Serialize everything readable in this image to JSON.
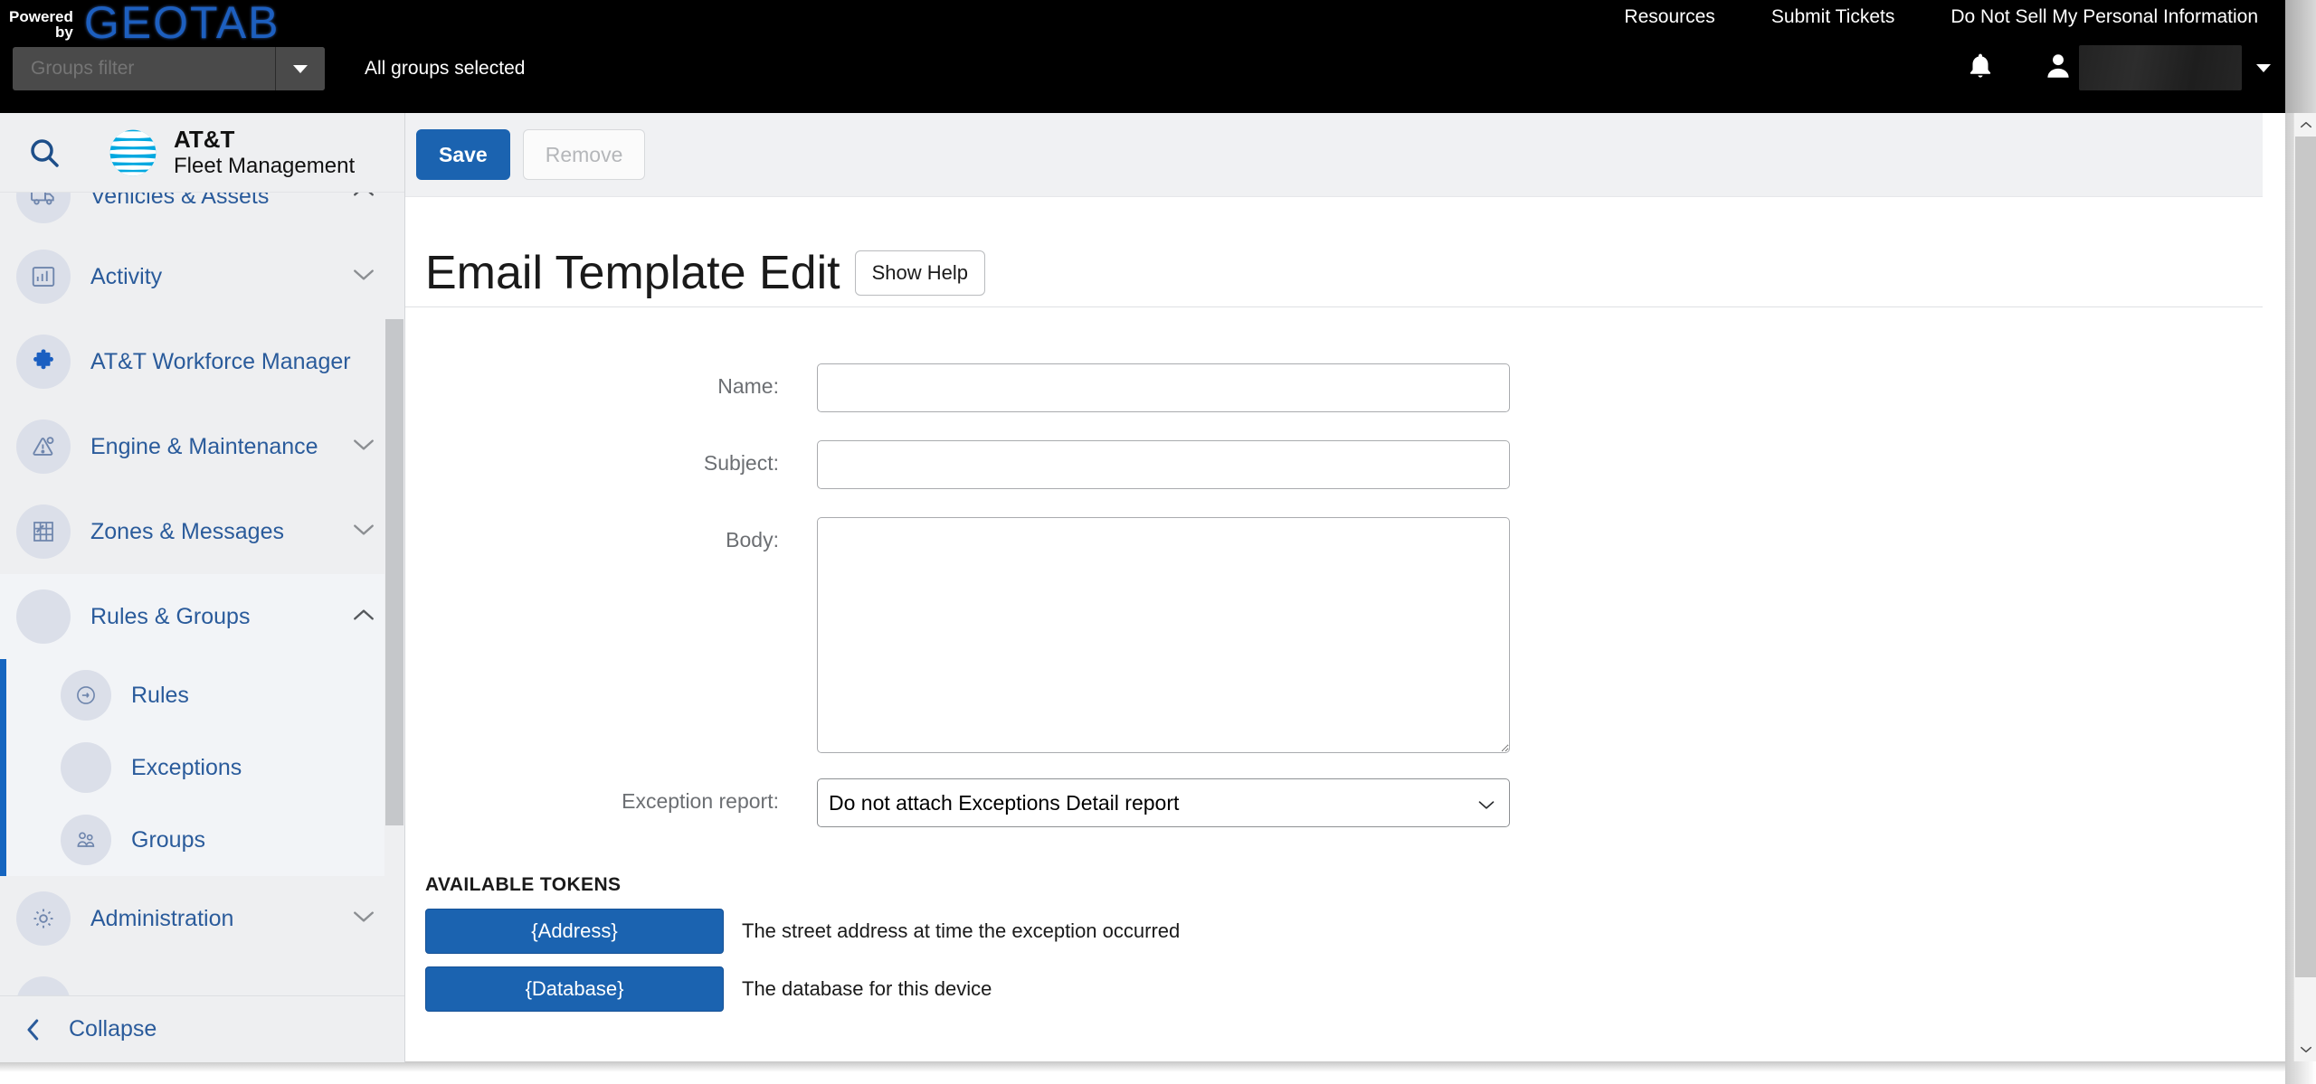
{
  "topbar": {
    "powered_line1": "Powered",
    "powered_line2": "by",
    "brand_word": "GEOTAB",
    "links": [
      {
        "label": "Resources",
        "name": "resources-link"
      },
      {
        "label": "Submit Tickets",
        "name": "submit-tickets-link"
      },
      {
        "label": "Do Not Sell My Personal Information",
        "name": "do-not-sell-link"
      }
    ],
    "groups_filter_placeholder": "Groups filter",
    "groups_filter_value": "",
    "all_groups_text": "All groups selected",
    "user_name": ""
  },
  "sidebar": {
    "product_name_line1": "AT&T",
    "product_name_line2": "Fleet Management",
    "items": [
      {
        "label": "Vehicles & Assets",
        "icon": "truck-icon",
        "chevron": "up",
        "expanded": false
      },
      {
        "label": "Activity",
        "icon": "bar-chart-icon",
        "chevron": "down",
        "expanded": false
      },
      {
        "label": "AT&T Workforce Manager",
        "icon": "puzzle-piece-icon",
        "chevron": "",
        "expanded": false
      },
      {
        "label": "Engine & Maintenance",
        "icon": "engine-warning-icon",
        "chevron": "down",
        "expanded": false
      },
      {
        "label": "Zones & Messages",
        "icon": "zones-map-icon",
        "chevron": "down",
        "expanded": false
      },
      {
        "label": "Rules & Groups",
        "icon": "rules-icon",
        "chevron": "up",
        "expanded": true
      }
    ],
    "sub_items": [
      {
        "label": "Rules",
        "icon": "rule-circle-icon"
      },
      {
        "label": "Exceptions",
        "icon": "exceptions-icon"
      },
      {
        "label": "Groups",
        "icon": "groups-people-icon"
      }
    ],
    "items_after": [
      {
        "label": "Administration",
        "icon": "gear-icon",
        "chevron": "down"
      }
    ],
    "collapse_label": "Collapse",
    "accent_color": "#1565c0",
    "link_color": "#2a5b9b"
  },
  "main": {
    "toolbar": {
      "save_label": "Save",
      "remove_label": "Remove"
    },
    "page_title": "Email Template Edit",
    "show_help_label": "Show Help",
    "form": {
      "name_label": "Name:",
      "name_value": "",
      "subject_label": "Subject:",
      "subject_value": "",
      "body_label": "Body:",
      "body_value": "",
      "exception_report_label": "Exception report:",
      "exception_report_value": "Do not attach Exceptions Detail report",
      "exception_report_options": [
        "Do not attach Exceptions Detail report"
      ]
    },
    "tokens_heading": "AVAILABLE TOKENS",
    "tokens": [
      {
        "token": "{Address}",
        "description": "The street address at time the exception occurred"
      },
      {
        "token": "{Database}",
        "description": "The database for this device"
      }
    ]
  },
  "colors": {
    "primary_blue": "#1b63b0",
    "topbar_black": "#000000",
    "geotab_blue": "#1d5fbf",
    "att_cyan": "#00a8e0"
  }
}
